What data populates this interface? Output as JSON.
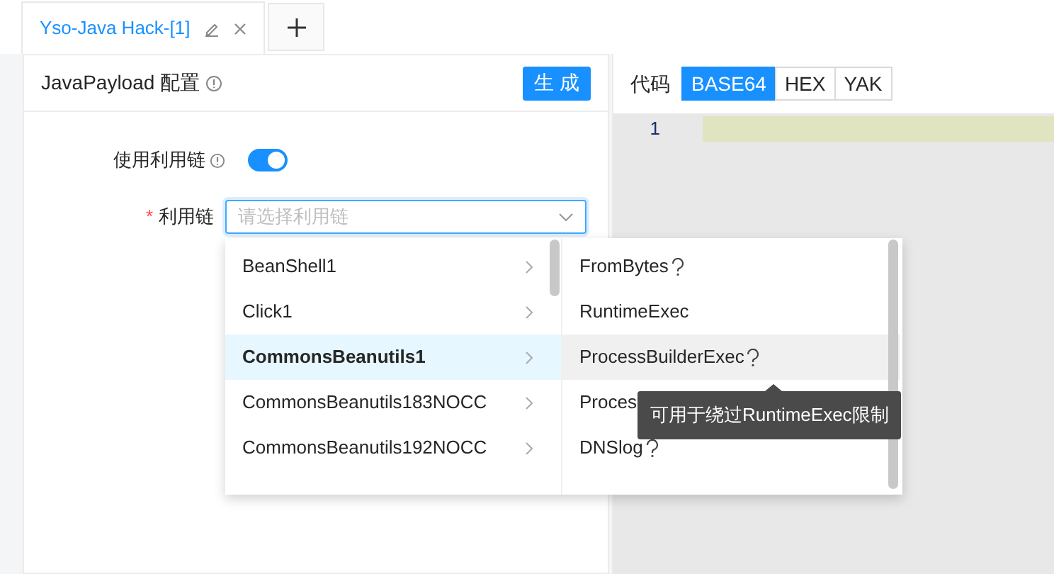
{
  "tabs": [
    {
      "label": "Yso-Java Hack-[1]",
      "selected": true,
      "editable": true,
      "closable": true
    }
  ],
  "config": {
    "title": "JavaPayload 配置",
    "generate_button": "生 成",
    "use_chain": {
      "label": "使用利用链",
      "on": true
    },
    "chain_field": {
      "required_mark": "*",
      "label": "利用链",
      "placeholder": "请选择利用链"
    }
  },
  "cascader": {
    "columns": [
      {
        "items": [
          {
            "label": "BeanShell1",
            "selected": false
          },
          {
            "label": "Click1",
            "selected": false
          },
          {
            "label": "CommonsBeanutils1",
            "selected": true
          },
          {
            "label": "CommonsBeanutils183NOCC",
            "selected": false
          },
          {
            "label": "CommonsBeanutils192NOCC",
            "selected": false
          }
        ]
      },
      {
        "items": [
          {
            "label": "FromBytes",
            "help": true,
            "hovered": false
          },
          {
            "label": "RuntimeExec",
            "help": false,
            "hovered": false
          },
          {
            "label": "ProcessBuilderExec",
            "help": true,
            "hovered": true
          },
          {
            "label": "Proces",
            "help": false,
            "hovered": false
          },
          {
            "label": "DNSlog",
            "help": true,
            "hovered": false
          }
        ]
      }
    ],
    "tooltip": "可用于绕过RuntimeExec限制"
  },
  "code": {
    "label": "代码",
    "formats": [
      {
        "label": "BASE64",
        "selected": true
      },
      {
        "label": "HEX",
        "selected": false
      },
      {
        "label": "YAK",
        "selected": false
      }
    ],
    "editor": {
      "line_numbers": [
        "1"
      ]
    }
  }
}
